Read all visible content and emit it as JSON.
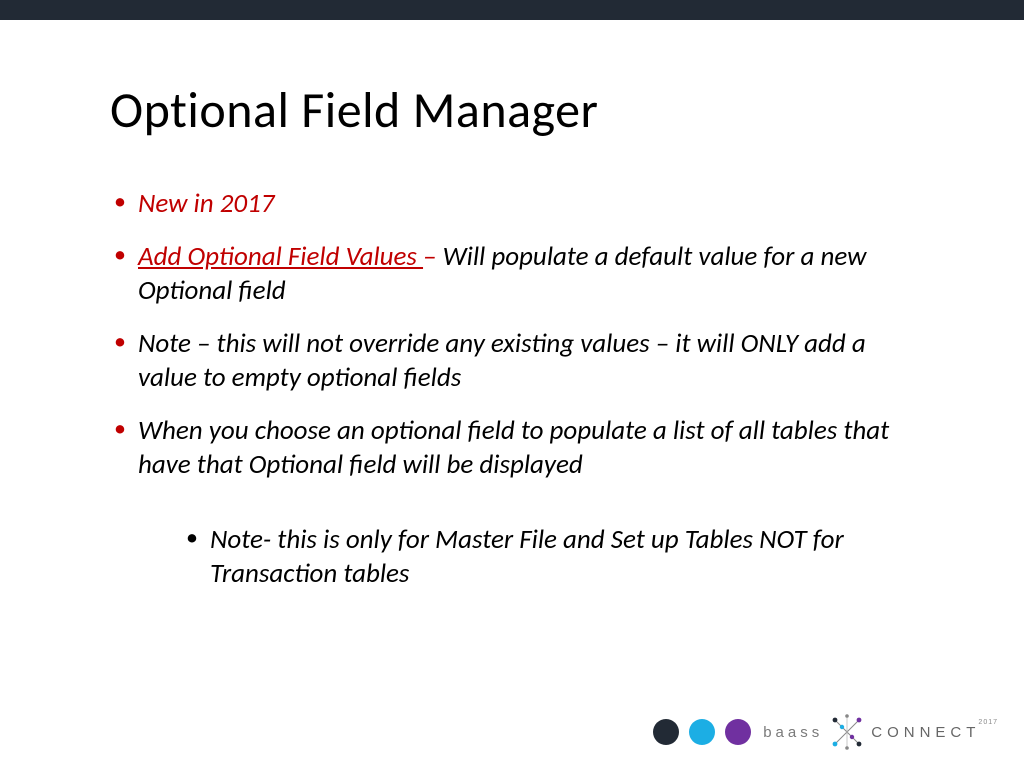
{
  "title": "Optional Field Manager",
  "bullets": {
    "b1_red": "New in 2017",
    "b2_link": "Add Optional Field Values ",
    "b2_dash": "–",
    "b2_rest": "  Will populate a default value for a new Optional field",
    "b3": " Note – this will not override any existing values – it will ONLY add a value to empty optional fields",
    "b4": "When you choose an optional field to populate a list of all tables that have that Optional field will be displayed",
    "sub1": "Note- this is only for Master File and Set up Tables NOT for Transaction tables"
  },
  "footer": {
    "brand_left": "baass",
    "brand_right": "CONNECT",
    "year": "2017"
  }
}
